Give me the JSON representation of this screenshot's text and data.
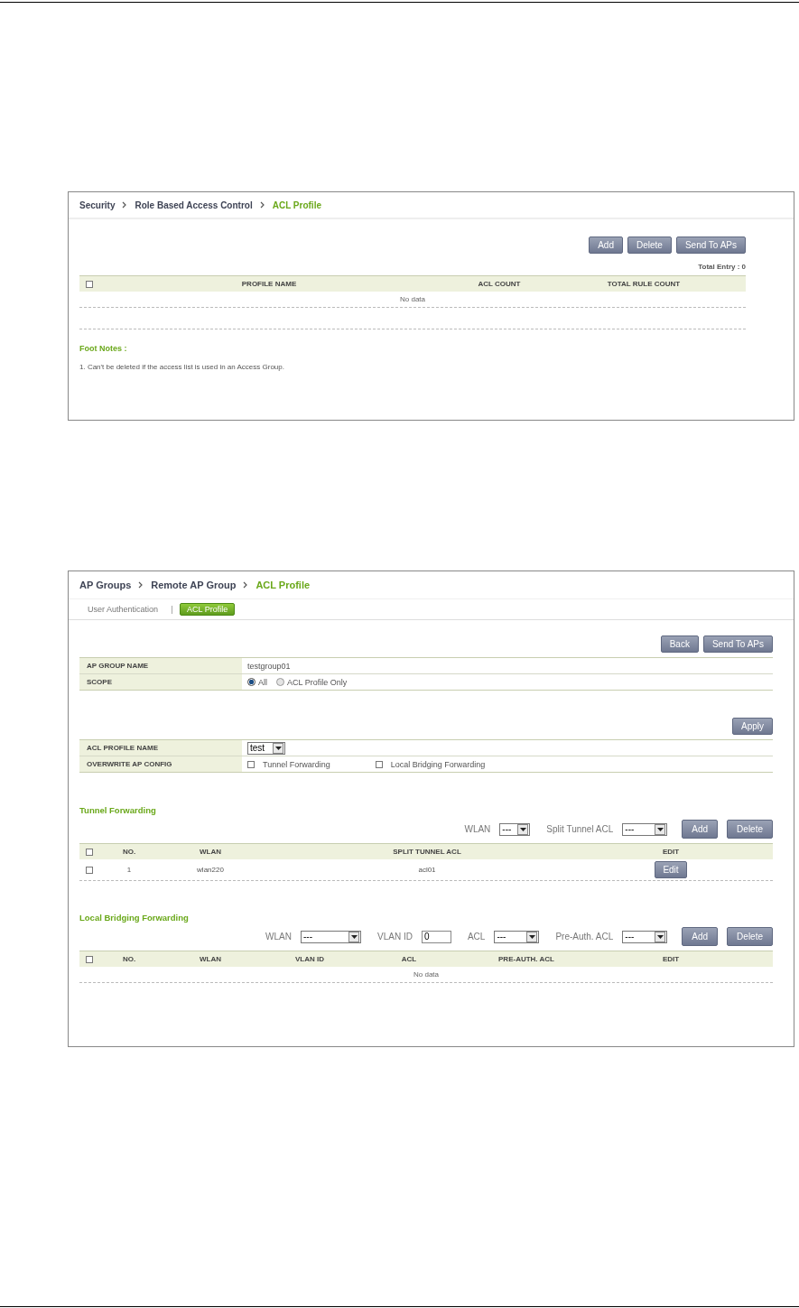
{
  "acl_profile_page": {
    "breadcrumb": [
      "Security",
      "Role Based Access Control",
      "ACL Profile"
    ],
    "buttons": [
      "Add",
      "Delete",
      "Send To APs"
    ],
    "total_entry": "Total Entry : 0",
    "table": {
      "select_all_checked": false,
      "columns": [
        "PROFILE NAME",
        "ACL COUNT",
        "TOTAL RULE COUNT"
      ],
      "empty_text": "No data"
    },
    "foot_notes_title": "Foot Notes :",
    "foot_notes": [
      "1. Can't be deleted if the access list is used in an Access Group."
    ]
  },
  "ap_group_page": {
    "breadcrumb": [
      "AP Groups",
      "Remote AP Group",
      "ACL Profile"
    ],
    "tabs": [
      {
        "label": "User Authentication",
        "selected": false
      },
      {
        "label": "ACL Profile",
        "selected": true
      }
    ],
    "top_buttons": [
      "Back",
      "Send To APs"
    ],
    "group_info": [
      {
        "label": "AP GROUP NAME",
        "kind": "text",
        "value": "testgroup01"
      },
      {
        "label": "SCOPE",
        "kind": "radio",
        "options": [
          {
            "label": "All",
            "selected": true
          },
          {
            "label": "ACL Profile Only",
            "selected": false
          }
        ]
      }
    ],
    "apply_button": "Apply",
    "profile_settings": [
      {
        "label": "ACL PROFILE NAME",
        "kind": "select",
        "value": "test"
      },
      {
        "label": "OVERWRITE AP CONFIG",
        "kind": "checkboxes",
        "options": [
          {
            "label": "Tunnel Forwarding",
            "checked": false
          },
          {
            "label": "Local Bridging Forwarding",
            "checked": false
          }
        ]
      }
    ],
    "tunnel_forwarding": {
      "title": "Tunnel Forwarding",
      "filters": [
        {
          "kind": "select",
          "label": "WLAN",
          "value": "---"
        },
        {
          "kind": "select",
          "label": "Split Tunnel ACL",
          "value": "---"
        }
      ],
      "buttons": [
        "Add",
        "Delete"
      ],
      "select_all_checked": false,
      "columns": [
        "NO.",
        "WLAN",
        "SPLIT TUNNEL ACL",
        "EDIT"
      ],
      "rows": [
        {
          "checked": false,
          "cells": [
            "1",
            "wlan220",
            "acl01"
          ],
          "edit_button": "Edit"
        }
      ]
    },
    "local_bridging": {
      "title": "Local Bridging Forwarding",
      "filters": [
        {
          "kind": "select",
          "label": "WLAN",
          "value": "---"
        },
        {
          "kind": "input",
          "label": "VLAN ID",
          "value": "0"
        },
        {
          "kind": "select",
          "label": "ACL",
          "value": "---"
        },
        {
          "kind": "select",
          "label": "Pre-Auth. ACL",
          "value": "---"
        }
      ],
      "buttons": [
        "Add",
        "Delete"
      ],
      "select_all_checked": false,
      "columns": [
        "NO.",
        "WLAN",
        "VLAN ID",
        "ACL",
        "PRE-AUTH. ACL",
        "EDIT"
      ],
      "empty_text": "No data"
    }
  }
}
